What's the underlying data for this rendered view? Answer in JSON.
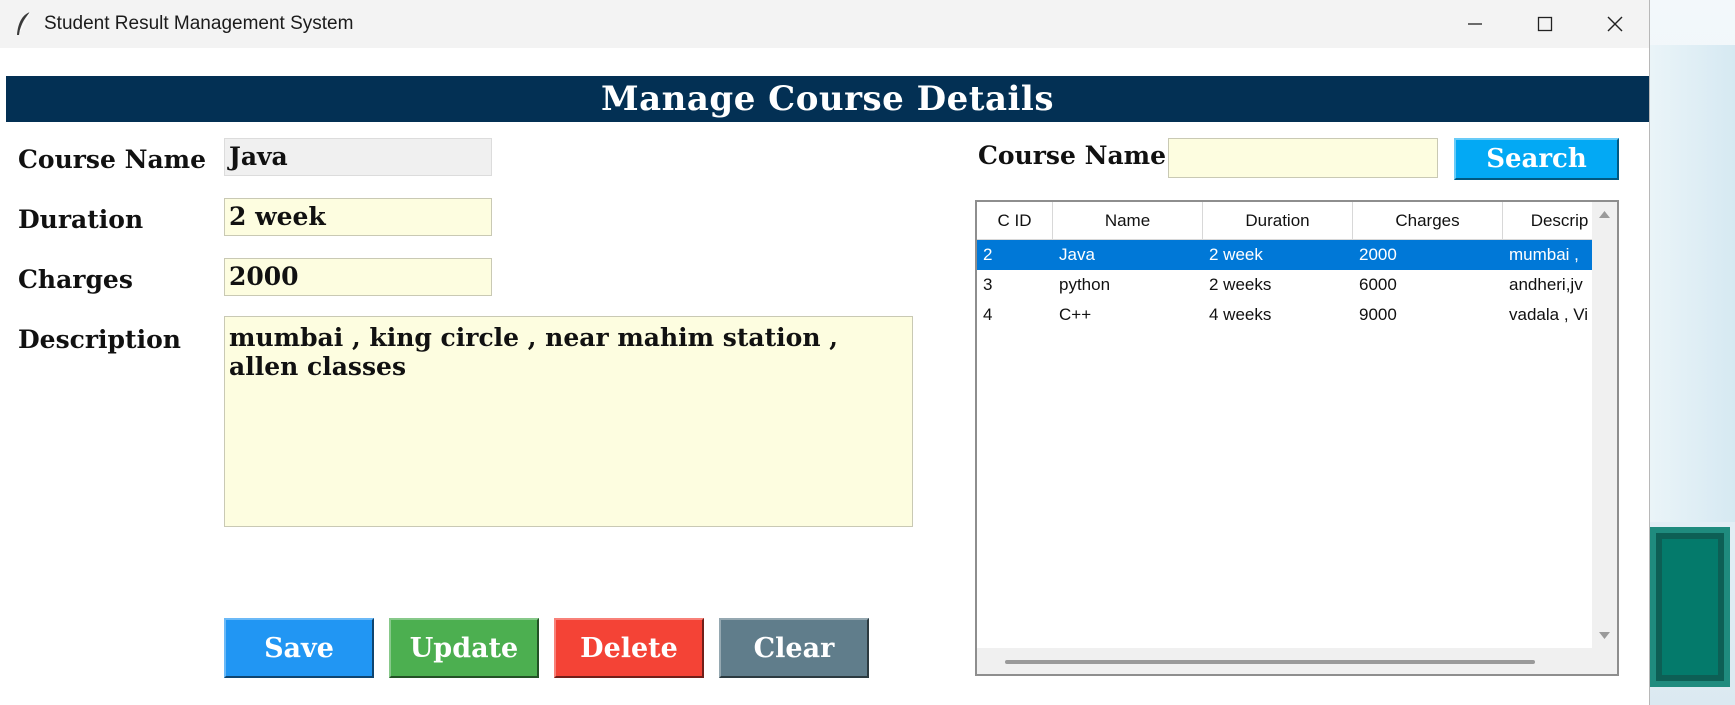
{
  "window": {
    "title": "Student Result Management System",
    "icons": [
      "feather-icon",
      "minimize-icon",
      "maximize-icon",
      "close-icon"
    ]
  },
  "header": {
    "title": "Manage Course Details"
  },
  "form": {
    "course_name_label": "Course Name",
    "course_name_value": "Java",
    "duration_label": "Duration",
    "duration_value": "2 week",
    "charges_label": "Charges",
    "charges_value": "2000",
    "description_label": "Description",
    "description_value": "mumbai , king circle , near mahim station , allen classes"
  },
  "buttons": {
    "save": "Save",
    "update": "Update",
    "delete": "Delete",
    "clear": "Clear"
  },
  "search": {
    "label": "Course Name",
    "value": "",
    "button": "Search"
  },
  "table": {
    "columns": [
      "C ID",
      "Name",
      "Duration",
      "Charges",
      "Descrip"
    ],
    "rows": [
      {
        "cid": "2",
        "name": "Java",
        "duration": "2 week",
        "charges": "2000",
        "description": "mumbai ,",
        "selected": true
      },
      {
        "cid": "3",
        "name": "python",
        "duration": "2 weeks",
        "charges": "6000",
        "description": "andheri,jv",
        "selected": false
      },
      {
        "cid": "4",
        "name": "C++",
        "duration": "4 weeks",
        "charges": "9000",
        "description": "vadala , Vi",
        "selected": false
      }
    ]
  },
  "colors": {
    "header_bg": "#033054",
    "field_bg": "#fdfde0",
    "save": "#2196f3",
    "update": "#4caf50",
    "delete": "#f44336",
    "clear": "#607d8b",
    "search": "#03a9f4",
    "row_selected": "#0078d7"
  }
}
